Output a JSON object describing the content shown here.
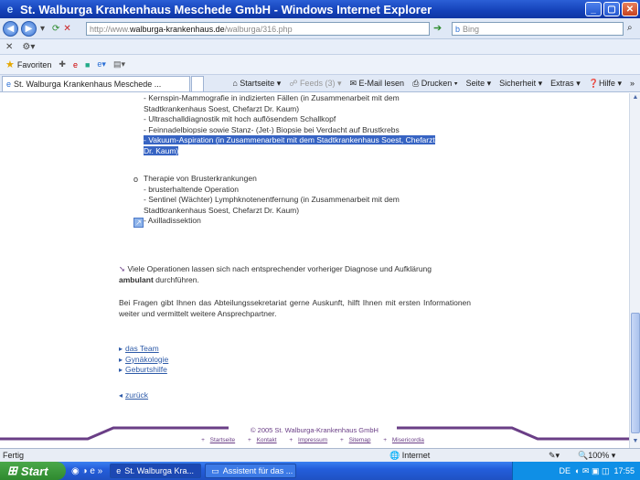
{
  "window": {
    "title": "St. Walburga Krankenhaus Meschede GmbH - Windows Internet Explorer"
  },
  "address": {
    "prefix": "http://www.",
    "domain": "walburga-krankenhaus.de",
    "path": "/walburga/316.php",
    "search_placeholder": "Bing"
  },
  "favorites": {
    "label": "Favoriten"
  },
  "tab": {
    "label": "St. Walburga Krankenhaus Meschede ..."
  },
  "toolbar": {
    "home": "Startseite",
    "feeds": "Feeds (3)",
    "mail": "E-Mail lesen",
    "print": "Drucken",
    "page": "Seite",
    "security": "Sicherheit",
    "extras": "Extras",
    "help": "Hilfe"
  },
  "content": {
    "lines_top": [
      "- Kernspin-Mammografie in indizierten Fällen (in Zusammenarbeit mit dem",
      "Stadtkrankenhaus Soest, Chefarzt Dr. Kaum)",
      "- Ultraschalldiagnostik mit hoch auflösendem Schallkopf",
      "- Feinnadelbiopsie sowie Stanz- (Jet-) Biopsie bei Verdacht auf Brustkrebs",
      "- Vakuum-Aspiration (in Zusammenarbeit mit dem Stadtkrankenhaus Soest, Chefarzt",
      "Dr. Kaum)"
    ],
    "therapy_title": "Therapie von Brusterkrankungen",
    "therapy_lines": [
      "- brusterhaltende Operation",
      "- Sentinel (Wächter) Lymphknotenentfernung (in Zusammenarbeit mit dem",
      "Stadtkrankenhaus Soest, Chefarzt Dr. Kaum)",
      "- Axilladissektion"
    ],
    "para1_a": "Viele Operationen lassen sich nach entsprechender vorheriger Diagnose und Aufklärung",
    "para1_b_bold": "ambulant",
    "para1_b_rest": " durchführen.",
    "para2": "Bei Fragen gibt Ihnen das Abteilungssekretariat gerne Auskunft, hilft Ihnen mit ersten Informationen weiter und vermittelt weitere Ansprechpartner.",
    "links": [
      "das Team",
      "Gynäkologie",
      "Geburtshilfe"
    ],
    "back": "zurück"
  },
  "footer": {
    "copyright": "© 2005 St. Walburga-Krankenhaus GmbH",
    "links": [
      "Startseite",
      "Kontakt",
      "Impressum",
      "Sitemap",
      "Misericordia"
    ]
  },
  "status": {
    "left": "Fertig",
    "zone": "Internet",
    "zoom": "100%"
  },
  "taskbar": {
    "start": "Start",
    "items": [
      "St. Walburga Kra...",
      "Assistent für das ..."
    ],
    "lang": "DE",
    "time": "17:55"
  },
  "colors": {
    "accent_purple": "#6a3e86",
    "link_blue": "#2d5aa8",
    "selection": "#3764c3"
  }
}
